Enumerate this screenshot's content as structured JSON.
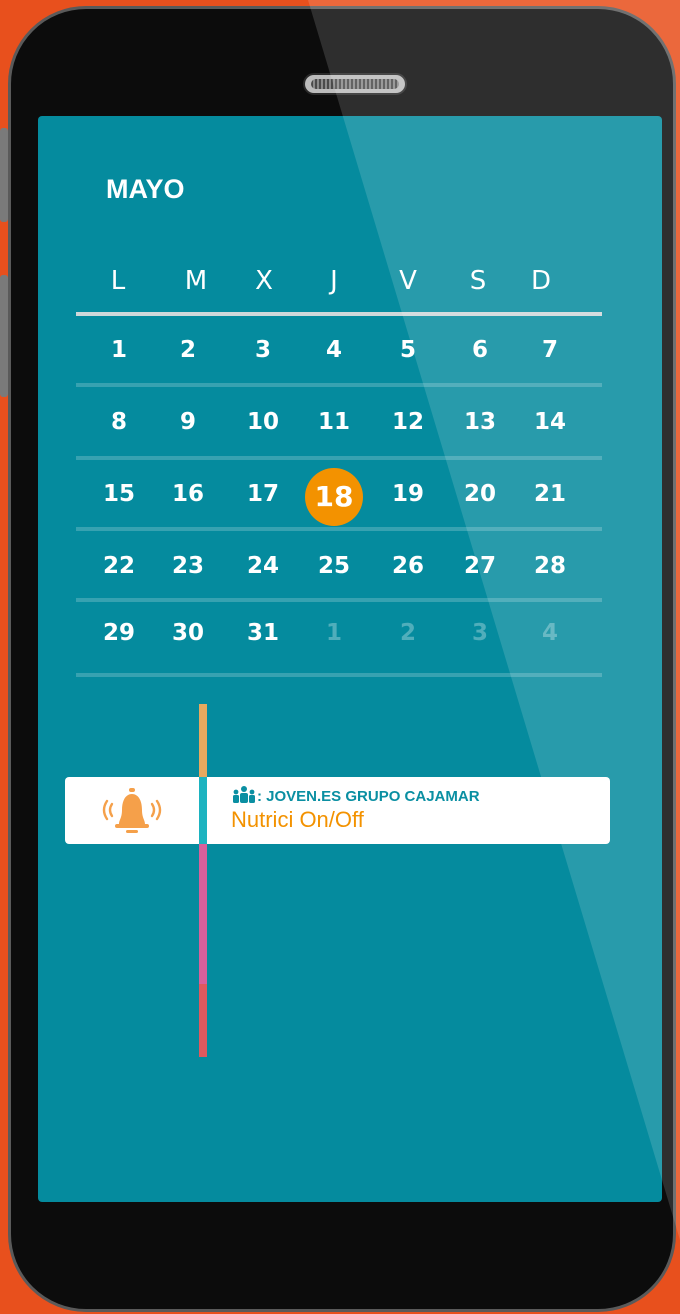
{
  "calendar": {
    "month": "MAYO",
    "weekdays": [
      "L",
      "M",
      "X",
      "J",
      "V",
      "S",
      "D"
    ],
    "weeks": [
      [
        "1",
        "2",
        "3",
        "4",
        "5",
        "6",
        "7"
      ],
      [
        "8",
        "9",
        "10",
        "11",
        "12",
        "13",
        "14"
      ],
      [
        "15",
        "16",
        "17",
        "18",
        "19",
        "20",
        "21"
      ],
      [
        "22",
        "23",
        "24",
        "25",
        "26",
        "27",
        "28"
      ],
      [
        "29",
        "30",
        "31",
        "1",
        "2",
        "3",
        "4"
      ]
    ],
    "selected_day": "18",
    "colors": {
      "background": "#058b9e",
      "selected": "#f39200"
    }
  },
  "event": {
    "group_label": ": JOVEN.ES GRUPO CAJAMAR",
    "title": "Nutrici On/Off",
    "icon": "bell-icon",
    "group_icon": "group-icon"
  },
  "timeline": {
    "colors": [
      "#e8a95e",
      "#1db3c0",
      "#d9609b",
      "#e0595e"
    ]
  },
  "frame_color": "#e8501d"
}
